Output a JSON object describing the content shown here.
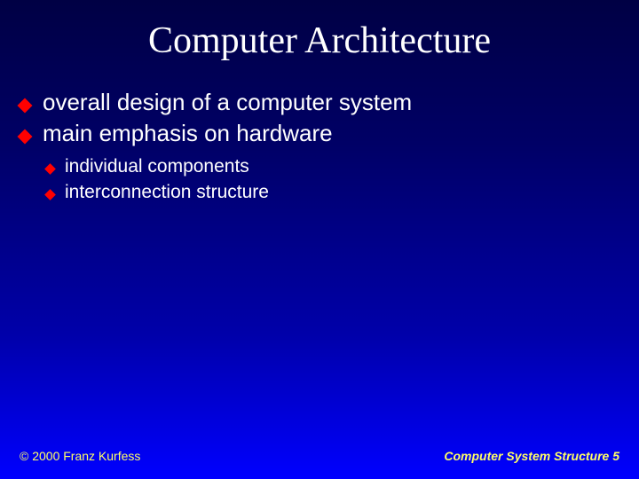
{
  "title": "Computer Architecture",
  "bullets": {
    "b1": "overall design of a computer system",
    "b2": "main emphasis on hardware",
    "sub1": "individual components",
    "sub2": "interconnection structure"
  },
  "footer": {
    "copyright": "© 2000 Franz Kurfess",
    "topic": "Computer System Structure  5"
  }
}
